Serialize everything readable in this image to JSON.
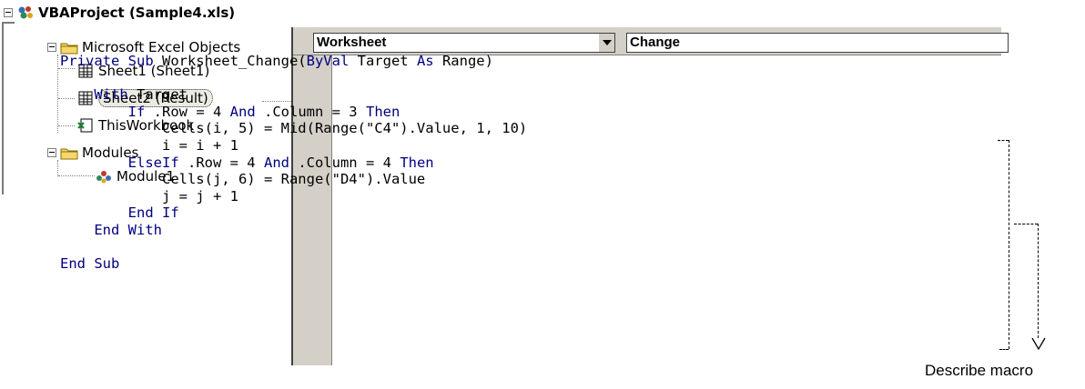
{
  "project_tree": {
    "root": "VBAProject (Sample4.xls)",
    "folders": [
      {
        "label": "Microsoft Excel Objects",
        "items": [
          {
            "label": "Sheet1 (Sheet1)",
            "icon": "worksheet-icon"
          },
          {
            "label": "Sheet2 (Result)",
            "icon": "worksheet-icon",
            "selected": true
          },
          {
            "label": "ThisWorkbook",
            "icon": "workbook-icon"
          }
        ]
      },
      {
        "label": "Modules",
        "items": [
          {
            "label": "Module1",
            "icon": "module-icon"
          }
        ]
      }
    ]
  },
  "code_window": {
    "object_combo": "Worksheet",
    "procedure_combo": "Change",
    "code_lines": [
      [
        {
          "t": "Private Sub ",
          "k": true
        },
        {
          "t": "Worksheet_Change("
        },
        {
          "t": "ByVal",
          "k": true
        },
        {
          "t": " Target "
        },
        {
          "t": "As",
          "k": true
        },
        {
          "t": " Range)"
        }
      ],
      [
        {
          "t": ""
        }
      ],
      [
        {
          "t": "    "
        },
        {
          "t": "With",
          "k": true
        },
        {
          "t": " Target"
        }
      ],
      [
        {
          "t": "        "
        },
        {
          "t": "If",
          "k": true
        },
        {
          "t": " .Row = 4 "
        },
        {
          "t": "And",
          "k": true
        },
        {
          "t": " .Column = 3 "
        },
        {
          "t": "Then",
          "k": true
        }
      ],
      [
        {
          "t": "            Cells(i, 5) = Mid(Range(\"C4\").Value, 1, 10)"
        }
      ],
      [
        {
          "t": "            i = i + 1"
        }
      ],
      [
        {
          "t": "        "
        },
        {
          "t": "ElseIf",
          "k": true
        },
        {
          "t": " .Row = 4 "
        },
        {
          "t": "And",
          "k": true
        },
        {
          "t": " .Column = 4 "
        },
        {
          "t": "Then",
          "k": true
        }
      ],
      [
        {
          "t": "            Cells(j, 6) = Range(\"D4\").Value"
        }
      ],
      [
        {
          "t": "            j = j + 1"
        }
      ],
      [
        {
          "t": "        "
        },
        {
          "t": "End If",
          "k": true
        }
      ],
      [
        {
          "t": "    "
        },
        {
          "t": "End With",
          "k": true
        }
      ],
      [
        {
          "t": ""
        }
      ],
      [
        {
          "t": "End Sub",
          "k": true
        }
      ]
    ]
  },
  "caption": "Describe macro",
  "colors": {
    "keyword": "#00007f",
    "panel": "#d4d0c8",
    "selection": "#ecebe2"
  }
}
